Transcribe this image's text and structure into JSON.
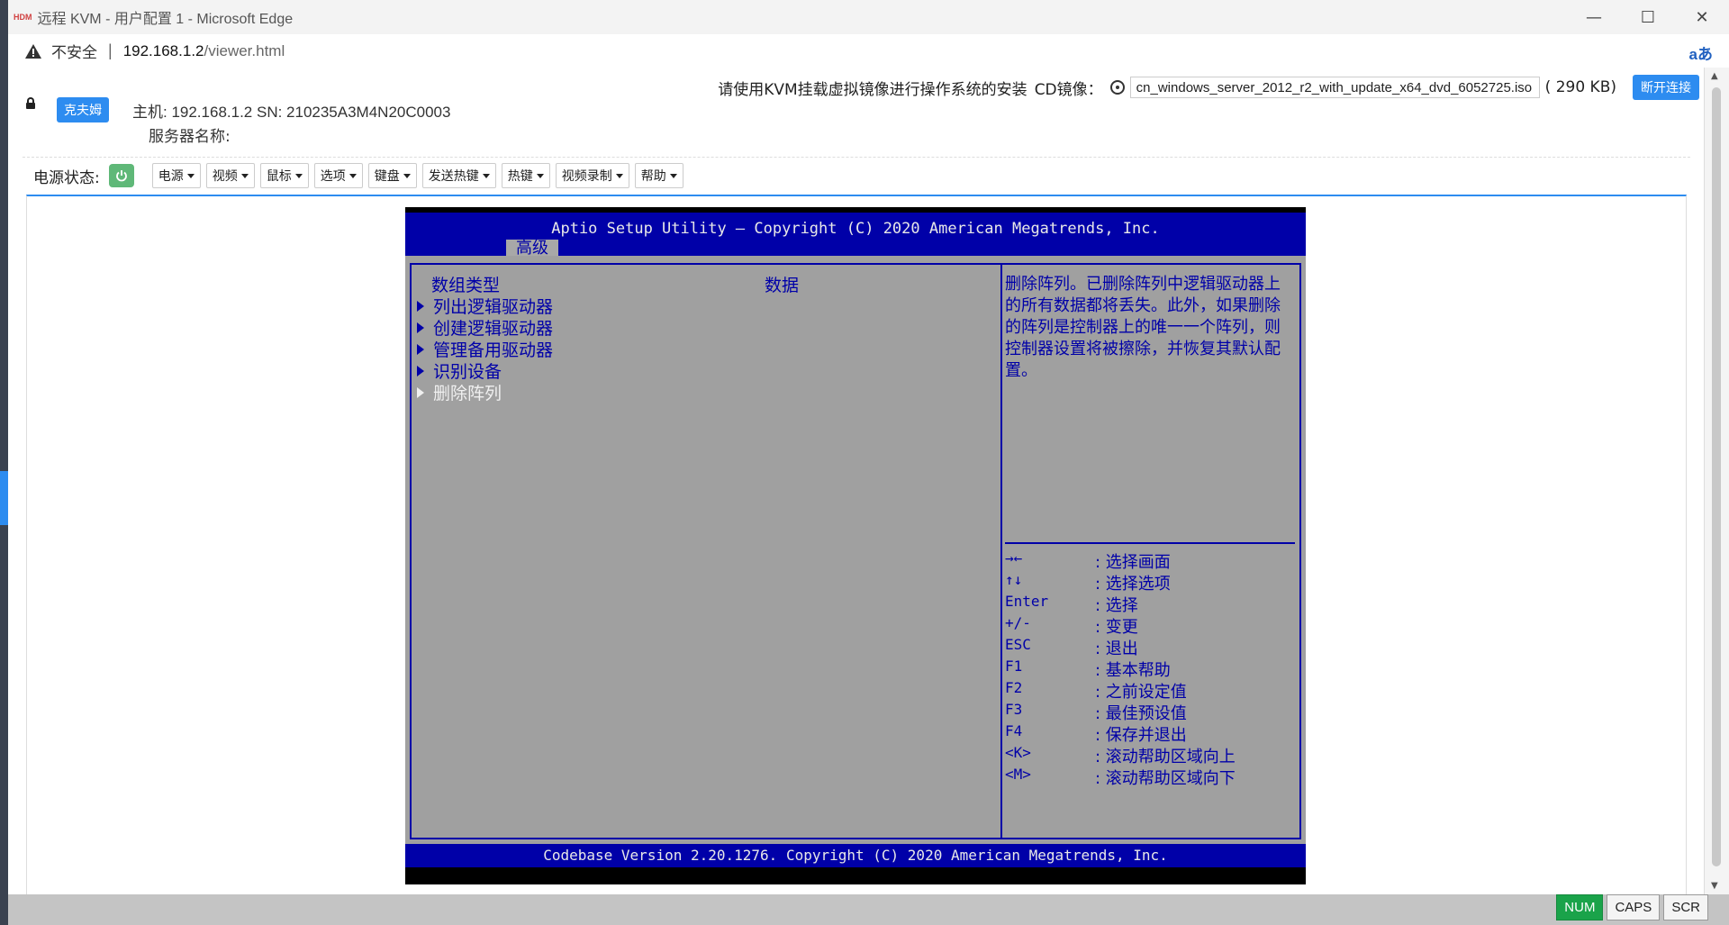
{
  "window": {
    "app_logo": "HDM",
    "title": "远程 KVM - 用户配置 1 - Microsoft Edge",
    "minimize": "—",
    "maximize": "☐",
    "close": "✕"
  },
  "addressbar": {
    "security_label": "不安全",
    "separator": "|",
    "url_host": "192.168.1.2",
    "url_path": "/viewer.html",
    "read_aloud": "aあ"
  },
  "header": {
    "hint": "请使用KVM挂载虚拟镜像进行操作系统的安装",
    "cd_label": "CD镜像：",
    "iso_value": "cn_windows_server_2012_r2_with_update_x64_dvd_6052725.iso",
    "iso_size": "( 290 KB)",
    "disconnect": "断开连接",
    "user_button": "克夫姆",
    "host_line": "主机:   192.168.1.2 SN:   210235A3M4N20C0003",
    "server_name": "服务器名称:"
  },
  "toolbar": {
    "power_label": "电源状态:",
    "menus": [
      "电源",
      "视频",
      "鼠标",
      "选项",
      "键盘",
      "发送热键",
      "热键",
      "视频录制",
      "帮助"
    ]
  },
  "bios": {
    "title": "Aptio Setup Utility – Copyright (C) 2020 American Megatrends, Inc.",
    "tab": "高级",
    "col_type": "数组类型",
    "col_data": "数据",
    "items": [
      "列出逻辑驱动器",
      "创建逻辑驱动器",
      "管理备用驱动器",
      "识别设备",
      "删除阵列"
    ],
    "selected_item": "删除阵列",
    "help": "删除阵列。已删除阵列中逻辑驱动器上的所有数据都将丢失。此外，如果删除的阵列是控制器上的唯一一个阵列，则控制器设置将被擦除，并恢复其默认配置。",
    "keys": [
      {
        "key": "→←",
        "desc": ": 选择画面"
      },
      {
        "key": "↑↓",
        "desc": ": 选择选项"
      },
      {
        "key": "Enter",
        "desc": ": 选择"
      },
      {
        "key": "+/-",
        "desc": ": 变更"
      },
      {
        "key": "ESC",
        "desc": ": 退出"
      },
      {
        "key": "F1",
        "desc": ": 基本帮助"
      },
      {
        "key": "F2",
        "desc": ": 之前设定值"
      },
      {
        "key": "F3",
        "desc": ": 最佳预设值"
      },
      {
        "key": "F4",
        "desc": ": 保存并退出"
      },
      {
        "key": "<K>",
        "desc": ": 滚动帮助区域向上"
      },
      {
        "key": "<M>",
        "desc": ": 滚动帮助区域向下"
      }
    ],
    "footer": "Codebase Version 2.20.1276. Copyright (C) 2020 American Megatrends, Inc."
  },
  "statusbar": {
    "num": "NUM",
    "caps": "CAPS",
    "scr": "SCR"
  },
  "colors": {
    "bios_blue": "#0000a8",
    "bios_gray": "#a0a0a0",
    "accent": "#2d8cf0",
    "power_green": "#5fb878",
    "num_on": "#1aa34a"
  }
}
